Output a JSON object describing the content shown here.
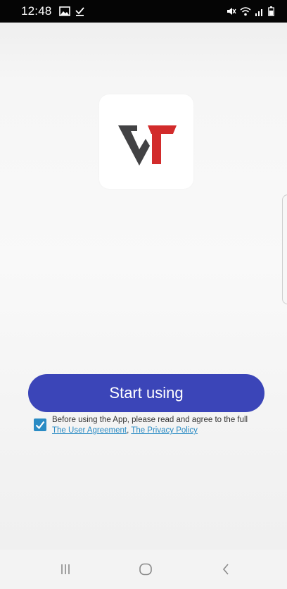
{
  "status_bar": {
    "time": "12:48",
    "left_icons": [
      "gallery-icon",
      "download-done-icon"
    ],
    "right_icons": [
      "mute-icon",
      "wifi-icon",
      "signal-icon",
      "battery-icon"
    ]
  },
  "app": {
    "logo_icon": "vt-logo-icon",
    "colors": {
      "logo_dark": "#424244",
      "logo_red": "#d22b2b",
      "primary_button": "#3b45b8",
      "link": "#2a8bc4"
    }
  },
  "start_button": {
    "label": "Start using"
  },
  "agreement": {
    "checked": true,
    "text_before": "Before using the App, please read and agree to the full ",
    "user_agreement_link": "The User Agreement",
    "separator": ", ",
    "privacy_policy_link": "The Privacy Policy"
  },
  "nav_bar": {
    "buttons": [
      "recent-apps-icon",
      "home-icon",
      "back-icon"
    ]
  }
}
